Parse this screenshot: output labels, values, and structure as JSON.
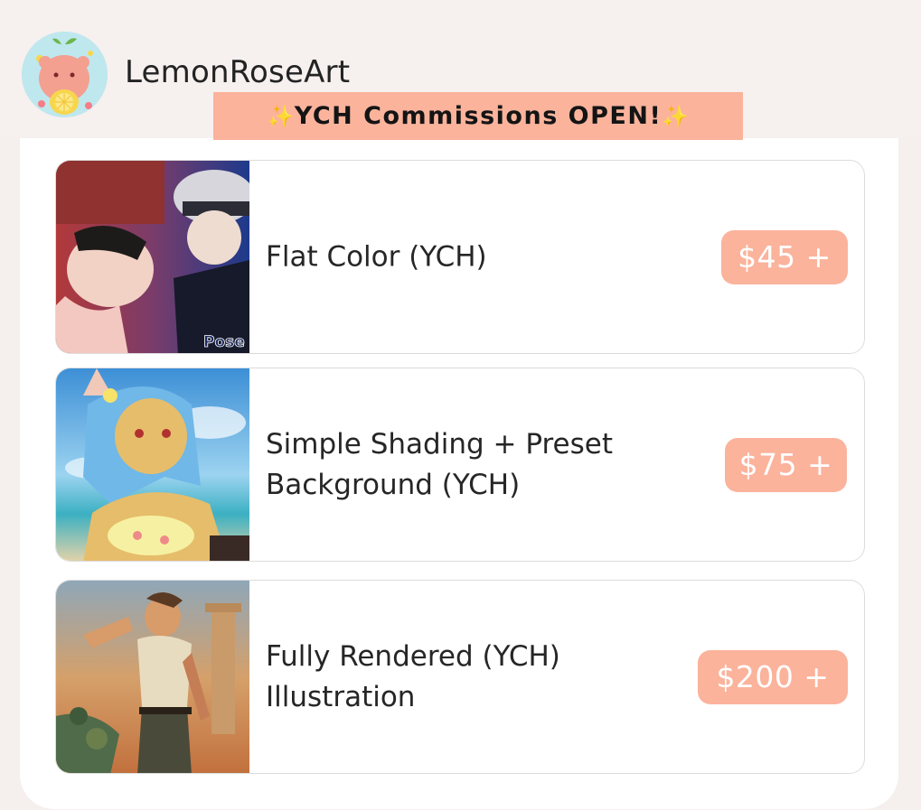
{
  "profile": {
    "shop_name": "LemonRoseArt",
    "avatar_icon": "hamster-lemon-avatar"
  },
  "banner": {
    "text": "YCH Commissions OPEN!",
    "sparkle": "✨"
  },
  "listings": [
    {
      "title": "Flat Color (YCH)",
      "price": "$45 +",
      "image_icon": "flat-color-artwork-thumbnail",
      "watermark": "Pose"
    },
    {
      "title": "Simple Shading + Preset Background (YCH)",
      "price": "$75 +",
      "image_icon": "simple-shading-artwork-thumbnail"
    },
    {
      "title": "Fully Rendered (YCH) Illustration",
      "price": "$200 +",
      "image_icon": "fully-rendered-artwork-thumbnail"
    }
  ],
  "colors": {
    "accent": "#fbb39c",
    "background": "#f5efee",
    "text": "#262626"
  }
}
